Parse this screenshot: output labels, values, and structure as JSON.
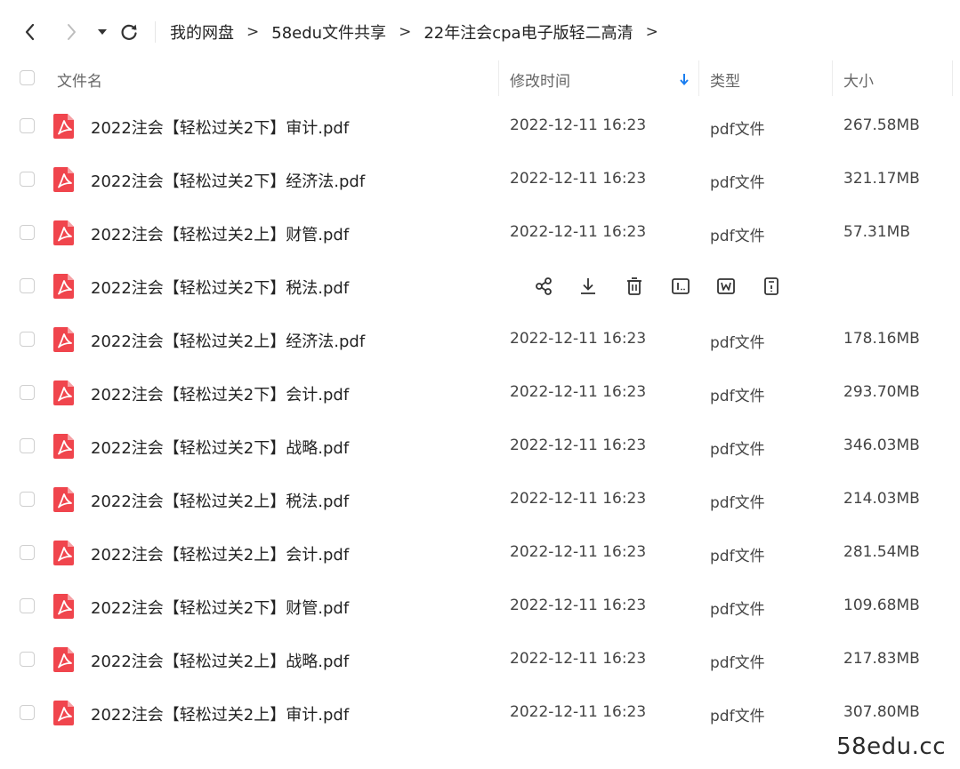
{
  "toolbar": {
    "back_icon": "chevron-left-icon",
    "forward_icon": "chevron-right-icon",
    "dropdown_icon": "caret-down-icon",
    "refresh_icon": "refresh-icon"
  },
  "breadcrumb": {
    "items": [
      "我的网盘",
      "58edu文件共享",
      "22年注会cpa电子版轻二高清"
    ],
    "separator": ">"
  },
  "table": {
    "headers": {
      "name": "文件名",
      "modified": "修改时间",
      "type": "类型",
      "size": "大小"
    },
    "sort_icon": "arrow-down-icon",
    "sort_color": "#1a7ef0",
    "file_icon_color": "#f0454d",
    "rows": [
      {
        "name": "2022注会【轻松过关2下】审计.pdf",
        "modified": "2022-12-11 16:23",
        "type": "pdf文件",
        "size": "267.58MB"
      },
      {
        "name": "2022注会【轻松过关2下】经济法.pdf",
        "modified": "2022-12-11 16:23",
        "type": "pdf文件",
        "size": "321.17MB"
      },
      {
        "name": "2022注会【轻松过关2上】财管.pdf",
        "modified": "2022-12-11 16:23",
        "type": "pdf文件",
        "size": "57.31MB"
      },
      {
        "name": "2022注会【轻松过关2下】税法.pdf",
        "hovered": true,
        "actions": [
          "share-icon",
          "download-icon",
          "delete-icon",
          "rename-icon",
          "move-icon",
          "more-icon"
        ]
      },
      {
        "name": "2022注会【轻松过关2上】经济法.pdf",
        "modified": "2022-12-11 16:23",
        "type": "pdf文件",
        "size": "178.16MB"
      },
      {
        "name": "2022注会【轻松过关2下】会计.pdf",
        "modified": "2022-12-11 16:23",
        "type": "pdf文件",
        "size": "293.70MB"
      },
      {
        "name": "2022注会【轻松过关2下】战略.pdf",
        "modified": "2022-12-11 16:23",
        "type": "pdf文件",
        "size": "346.03MB"
      },
      {
        "name": "2022注会【轻松过关2上】税法.pdf",
        "modified": "2022-12-11 16:23",
        "type": "pdf文件",
        "size": "214.03MB"
      },
      {
        "name": "2022注会【轻松过关2上】会计.pdf",
        "modified": "2022-12-11 16:23",
        "type": "pdf文件",
        "size": "281.54MB"
      },
      {
        "name": "2022注会【轻松过关2下】财管.pdf",
        "modified": "2022-12-11 16:23",
        "type": "pdf文件",
        "size": "109.68MB"
      },
      {
        "name": "2022注会【轻松过关2上】战略.pdf",
        "modified": "2022-12-11 16:23",
        "type": "pdf文件",
        "size": "217.83MB"
      },
      {
        "name": "2022注会【轻松过关2上】审计.pdf",
        "modified": "2022-12-11 16:23",
        "type": "pdf文件",
        "size": "307.80MB"
      }
    ]
  },
  "watermark": "58edu.cc"
}
